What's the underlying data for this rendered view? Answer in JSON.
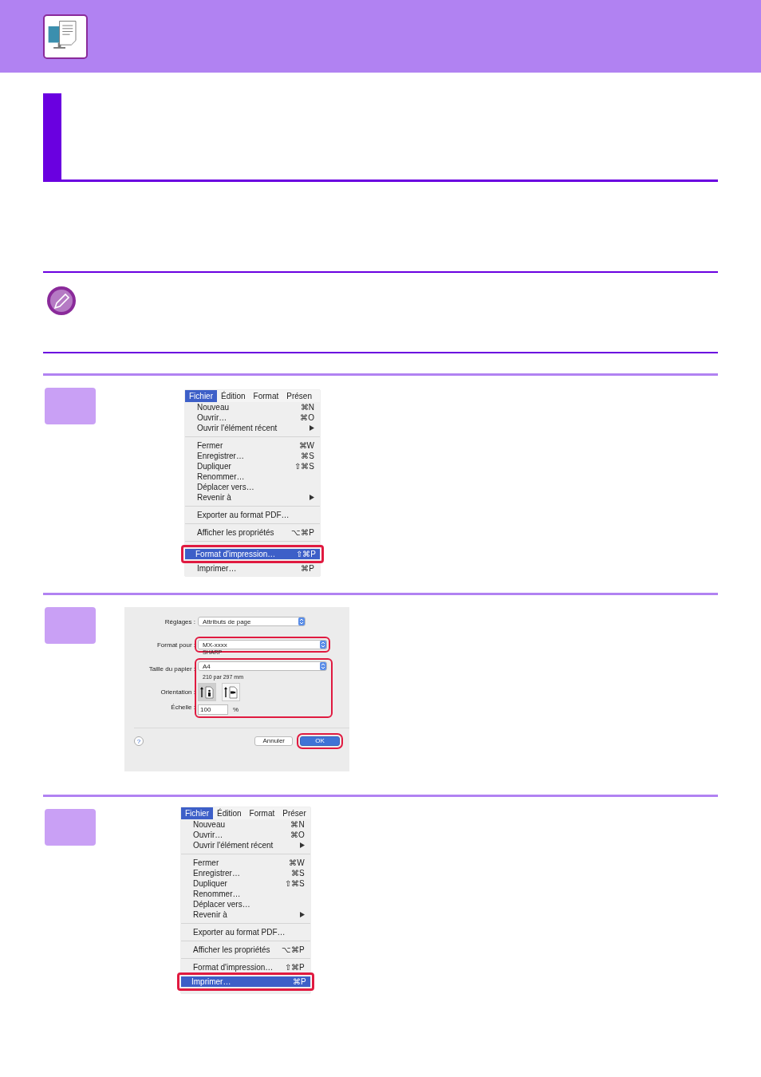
{
  "steps": [
    {
      "screenshot": {
        "kind": "menu",
        "menubar": [
          {
            "label": "Fichier",
            "selected": true
          },
          {
            "label": "Édition",
            "selected": false
          },
          {
            "label": "Format",
            "selected": false
          },
          {
            "label": "Présen",
            "selected": false
          }
        ],
        "items": [
          {
            "kind": "item",
            "label": "Nouveau",
            "shortcut": "⌘N",
            "submenu": false,
            "selected": false,
            "outlined": false
          },
          {
            "kind": "item",
            "label": "Ouvrir…",
            "shortcut": "⌘O",
            "submenu": false,
            "selected": false,
            "outlined": false
          },
          {
            "kind": "item",
            "label": "Ouvrir l'élément récent",
            "submenu": true,
            "selected": false,
            "outlined": false
          },
          {
            "kind": "separator"
          },
          {
            "kind": "item",
            "label": "Fermer",
            "shortcut": "⌘W",
            "submenu": false,
            "selected": false,
            "outlined": false
          },
          {
            "kind": "item",
            "label": "Enregistrer…",
            "shortcut": "⌘S",
            "submenu": false,
            "selected": false,
            "outlined": false
          },
          {
            "kind": "item",
            "label": "Dupliquer",
            "shortcut": "⇧⌘S",
            "submenu": false,
            "selected": false,
            "outlined": false
          },
          {
            "kind": "item",
            "label": "Renommer…",
            "submenu": false,
            "selected": false,
            "outlined": false
          },
          {
            "kind": "item",
            "label": "Déplacer vers…",
            "submenu": false,
            "selected": false,
            "outlined": false
          },
          {
            "kind": "item",
            "label": "Revenir à",
            "submenu": true,
            "selected": false,
            "outlined": false
          },
          {
            "kind": "separator"
          },
          {
            "kind": "item",
            "label": "Exporter au format PDF…",
            "submenu": false,
            "selected": false,
            "outlined": false
          },
          {
            "kind": "separator"
          },
          {
            "kind": "item",
            "label": "Afficher les propriétés",
            "shortcut": "⌥⌘P",
            "submenu": false,
            "selected": false,
            "outlined": false
          },
          {
            "kind": "separator"
          },
          {
            "kind": "item",
            "label": "Format d'impression…",
            "shortcut": "⇧⌘P",
            "submenu": false,
            "selected": true,
            "outlined": true
          },
          {
            "kind": "item",
            "label": "Imprimer…",
            "shortcut": "⌘P",
            "submenu": false,
            "selected": false,
            "outlined": false
          }
        ]
      }
    },
    {
      "screenshot": {
        "kind": "dialog",
        "settings": {
          "label": "Réglages :",
          "value": "Attributs de page",
          "outlined": false
        },
        "format_for": {
          "label": "Format pour :",
          "value": "MX-xxxx",
          "sub": "SHARP",
          "outlined": true
        },
        "paper_group": {
          "outlined": true,
          "paper": {
            "label": "Taille du papier :",
            "value": "A4",
            "sub": "210 par 297 mm"
          },
          "orientation": {
            "label": "Orientation :",
            "options": [
              {
                "kind": "portrait",
                "selected": true
              },
              {
                "kind": "landscape",
                "selected": false
              }
            ]
          },
          "scale": {
            "label": "Échelle :",
            "value": "100",
            "unit": "%"
          }
        },
        "help": "?",
        "buttons": [
          {
            "label": "Annuler",
            "kind": "secondary",
            "outlined": false
          },
          {
            "label": "OK",
            "kind": "default",
            "outlined": true
          }
        ]
      }
    },
    {
      "screenshot": {
        "kind": "menu",
        "menubar": [
          {
            "label": "Fichier",
            "selected": true
          },
          {
            "label": "Édition",
            "selected": false
          },
          {
            "label": "Format",
            "selected": false
          },
          {
            "label": "Préser",
            "selected": false
          }
        ],
        "items": [
          {
            "kind": "item",
            "label": "Nouveau",
            "shortcut": "⌘N",
            "submenu": false,
            "selected": false,
            "outlined": false
          },
          {
            "kind": "item",
            "label": "Ouvrir…",
            "shortcut": "⌘O",
            "submenu": false,
            "selected": false,
            "outlined": false
          },
          {
            "kind": "item",
            "label": "Ouvrir l'élément récent",
            "submenu": true,
            "selected": false,
            "outlined": false
          },
          {
            "kind": "separator"
          },
          {
            "kind": "item",
            "label": "Fermer",
            "shortcut": "⌘W",
            "submenu": false,
            "selected": false,
            "outlined": false
          },
          {
            "kind": "item",
            "label": "Enregistrer…",
            "shortcut": "⌘S",
            "submenu": false,
            "selected": false,
            "outlined": false
          },
          {
            "kind": "item",
            "label": "Dupliquer",
            "shortcut": "⇧⌘S",
            "submenu": false,
            "selected": false,
            "outlined": false
          },
          {
            "kind": "item",
            "label": "Renommer…",
            "submenu": false,
            "selected": false,
            "outlined": false
          },
          {
            "kind": "item",
            "label": "Déplacer vers…",
            "submenu": false,
            "selected": false,
            "outlined": false
          },
          {
            "kind": "item",
            "label": "Revenir à",
            "submenu": true,
            "selected": false,
            "outlined": false
          },
          {
            "kind": "separator"
          },
          {
            "kind": "item",
            "label": "Exporter au format PDF…",
            "submenu": false,
            "selected": false,
            "outlined": false
          },
          {
            "kind": "separator"
          },
          {
            "kind": "item",
            "label": "Afficher les propriétés",
            "shortcut": "⌥⌘P",
            "submenu": false,
            "selected": false,
            "outlined": false
          },
          {
            "kind": "separator"
          },
          {
            "kind": "item",
            "label": "Format d'impression…",
            "shortcut": "⇧⌘P",
            "submenu": false,
            "selected": false,
            "outlined": false
          },
          {
            "kind": "item",
            "label": "Imprimer…",
            "shortcut": "⌘P",
            "submenu": false,
            "selected": true,
            "outlined": true
          }
        ]
      }
    }
  ]
}
